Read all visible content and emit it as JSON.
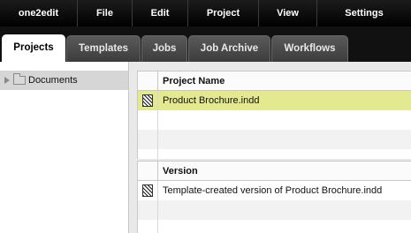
{
  "menubar": {
    "items": [
      "one2edit",
      "File",
      "Edit",
      "Project",
      "View",
      "Settings"
    ]
  },
  "tabs": {
    "items": [
      "Projects",
      "Templates",
      "Jobs",
      "Job Archive",
      "Workflows"
    ],
    "active": "Projects"
  },
  "tree": {
    "root_label": "Documents"
  },
  "projects_table": {
    "column_header": "Project Name",
    "rows": [
      "Product Brochure.indd"
    ],
    "selected_row": "Product Brochure.indd"
  },
  "versions_table": {
    "column_header": "Version",
    "rows": [
      "Template-created version of Product Brochure.indd"
    ]
  },
  "colors": {
    "menubar_bg": "#000000",
    "selected_row": "#e2e98f",
    "tree_selected": "#d6d6d6"
  }
}
